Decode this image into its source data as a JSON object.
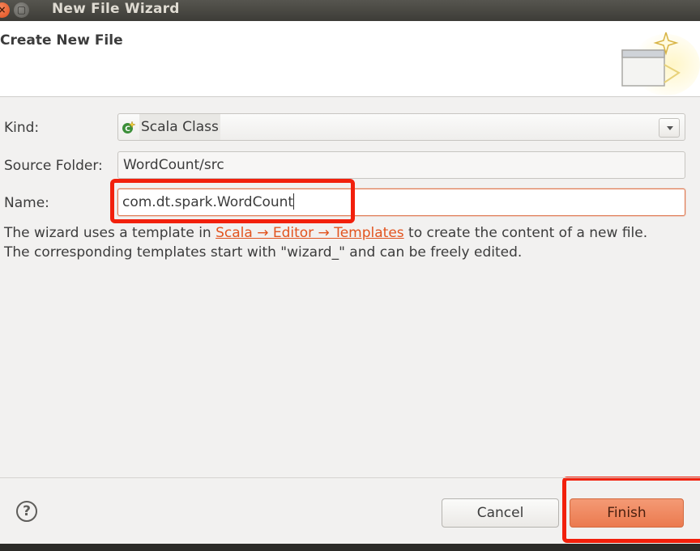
{
  "window": {
    "title": "New File Wizard",
    "close_glyph": "×",
    "maximize_glyph": "▢"
  },
  "header": {
    "title": "Create New File",
    "graphic": "new-file-wizard-banner-icon"
  },
  "form": {
    "kind": {
      "label": "Kind:",
      "value": "Scala Class",
      "icon": "scala-class-icon"
    },
    "source_folder": {
      "label": "Source Folder:",
      "value": "WordCount/src"
    },
    "name": {
      "label": "Name:",
      "value": "com.dt.spark.WordCount"
    }
  },
  "info": {
    "text_before": "The wizard uses a template in ",
    "link_text": "Scala → Editor → Templates",
    "text_after": " to create the content of a new file.",
    "line2": "The corresponding templates start with \"wizard_\" and can be freely edited."
  },
  "footer": {
    "help_glyph": "?",
    "cancel_label": "Cancel",
    "finish_label": "Finish"
  },
  "colors": {
    "annotation": "#f2200c",
    "link": "#e2541f",
    "finish_button": "#eb7a4f",
    "focus_border": "#e07a52"
  }
}
